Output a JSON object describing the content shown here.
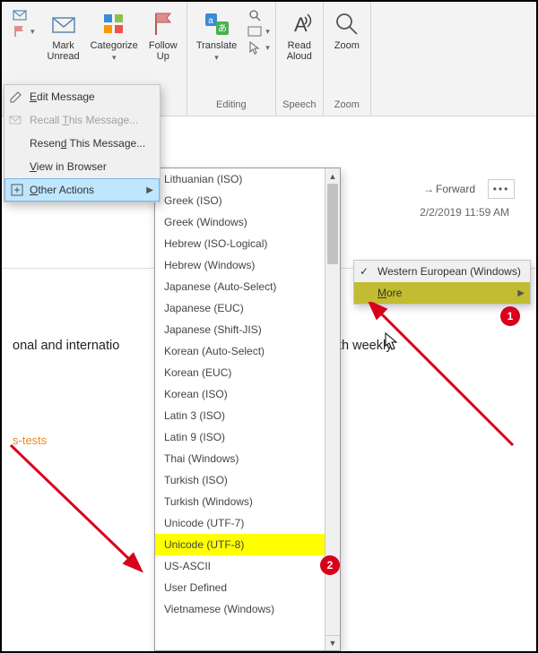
{
  "ribbon": {
    "first_group": {
      "mark_unread": "Mark\nUnread",
      "categorize": "Categorize",
      "follow_up": "Follow\nUp"
    },
    "editing": {
      "label": "Editing",
      "translate": "Translate"
    },
    "speech": {
      "label": "Speech",
      "read_aloud": "Read\nAloud"
    },
    "zoom": {
      "label": "Zoom",
      "zoom": "Zoom"
    }
  },
  "context_menu": {
    "edit_message": "Edit Message",
    "recall": "Recall This Message...",
    "resend": "Resend This Message...",
    "view_browser": "View in Browser",
    "other_actions": "Other Actions"
  },
  "encoding_submenu": {
    "western": "Western European (Windows)",
    "more": "More"
  },
  "encoding_list": [
    "Lithuanian (ISO)",
    "Greek (ISO)",
    "Greek (Windows)",
    "Hebrew (ISO-Logical)",
    "Hebrew (Windows)",
    "Japanese (Auto-Select)",
    "Japanese (EUC)",
    "Japanese (Shift-JIS)",
    "Korean (Auto-Select)",
    "Korean (EUC)",
    "Korean (ISO)",
    "Latin 3 (ISO)",
    "Latin 9 (ISO)",
    "Thai (Windows)",
    "Turkish (ISO)",
    "Turkish (Windows)",
    "Unicode (UTF-7)",
    "Unicode (UTF-8)",
    "US-ASCII",
    "User Defined",
    "Vietnamese (Windows)"
  ],
  "highlighted_index": 17,
  "email": {
    "forward": "Forward",
    "more": "•••",
    "date": "2/2/2019 11:59 AM",
    "body_fragment_left": "onal and internatio",
    "body_fragment_right": " with weekly",
    "link_fragment": "s-tests"
  },
  "badges": {
    "one": "1",
    "two": "2"
  }
}
